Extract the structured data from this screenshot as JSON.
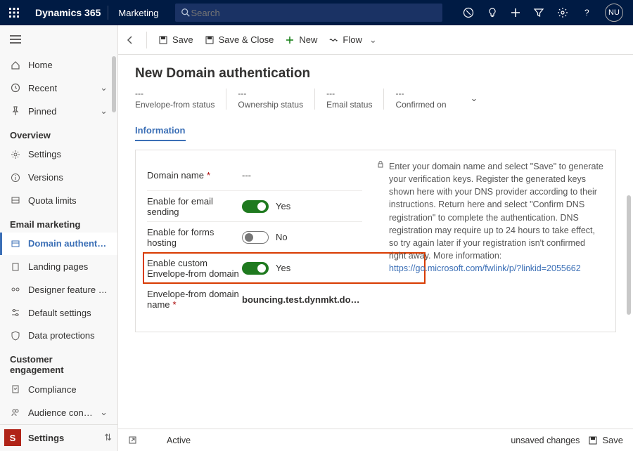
{
  "header": {
    "brand": "Dynamics 365",
    "module": "Marketing",
    "search_placeholder": "Search",
    "avatar": "NU"
  },
  "sidebar": {
    "items": [
      {
        "label": "Home"
      },
      {
        "label": "Recent"
      },
      {
        "label": "Pinned"
      }
    ],
    "section_overview": "Overview",
    "overview_items": [
      {
        "label": "Settings"
      },
      {
        "label": "Versions"
      },
      {
        "label": "Quota limits"
      }
    ],
    "section_email": "Email marketing",
    "email_items": [
      {
        "label": "Domain authentic…"
      },
      {
        "label": "Landing pages"
      },
      {
        "label": "Designer feature …"
      },
      {
        "label": "Default settings"
      },
      {
        "label": "Data protections"
      }
    ],
    "section_engagement": "Customer engagement",
    "eng_items": [
      {
        "label": "Compliance"
      },
      {
        "label": "Audience configur…"
      }
    ],
    "footer": {
      "badge": "S",
      "label": "Settings"
    }
  },
  "cmdbar": {
    "save": "Save",
    "saveclose": "Save & Close",
    "new": "New",
    "flow": "Flow"
  },
  "page": {
    "title": "New Domain authentication",
    "summary": [
      {
        "value": "---",
        "label": "Envelope-from status"
      },
      {
        "value": "---",
        "label": "Ownership status"
      },
      {
        "value": "---",
        "label": "Email status"
      },
      {
        "value": "---",
        "label": "Confirmed on"
      }
    ],
    "tab": "Information",
    "form": {
      "domain_name_label": "Domain name",
      "domain_name_value": "---",
      "email_send_label": "Enable for email sending",
      "email_send_value": "Yes",
      "forms_label": "Enable for forms hosting",
      "forms_value": "No",
      "custom_env_label": "Enable custom Envelope-from domain",
      "custom_env_value": "Yes",
      "env_domain_label": "Envelope-from domain name",
      "env_domain_value": "bouncing.test.dynmkt.do…"
    },
    "help_text": "Enter your domain name and select \"Save\" to generate your verification keys. Register the generated keys shown here with your DNS provider according to their instructions. Return here and select \"Confirm DNS registration\" to complete the authentication. DNS registration may require up to 24 hours to take effect, so try again later if your registration isn't confirmed right away. More information: ",
    "help_link": "https://go.microsoft.com/fwlink/p/?linkid=2055662"
  },
  "footer": {
    "status": "Active",
    "unsaved": "unsaved changes",
    "save": "Save"
  }
}
